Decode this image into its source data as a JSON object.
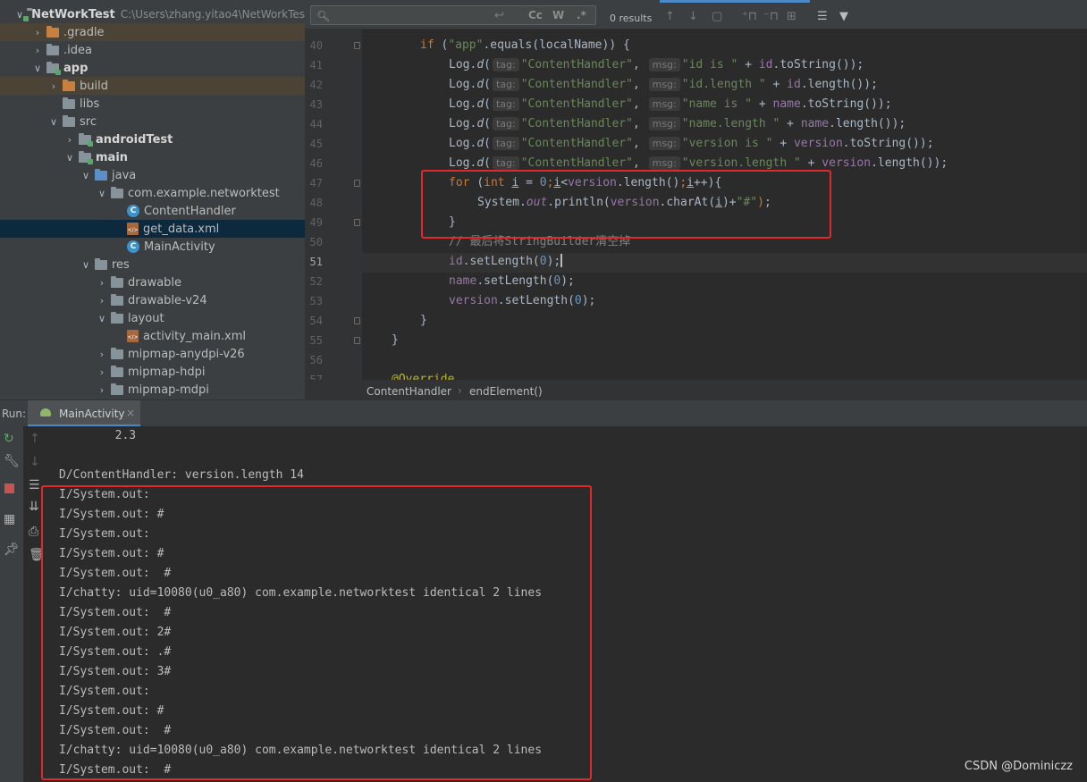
{
  "project_tree": {
    "items": [
      {
        "label": "NetWorkTest",
        "path": "C:\\Users\\zhang.yitao4\\NetWorkTes",
        "arrow": "v",
        "indent": 0,
        "icon": "folder-module",
        "bold": true
      },
      {
        "label": ".gradle",
        "arrow": ">",
        "indent": 1,
        "icon": "folder-orange",
        "highlight": true
      },
      {
        "label": ".idea",
        "arrow": ">",
        "indent": 1,
        "icon": "folder"
      },
      {
        "label": "app",
        "arrow": "v",
        "indent": 1,
        "icon": "folder-module",
        "bold": true
      },
      {
        "label": "build",
        "arrow": ">",
        "indent": 2,
        "icon": "folder-orange",
        "highlight": true
      },
      {
        "label": "libs",
        "arrow": "",
        "indent": 2,
        "icon": "folder"
      },
      {
        "label": "src",
        "arrow": "v",
        "indent": 2,
        "icon": "folder"
      },
      {
        "label": "androidTest",
        "arrow": ">",
        "indent": 3,
        "icon": "folder-module",
        "bold": true
      },
      {
        "label": "main",
        "arrow": "v",
        "indent": 3,
        "icon": "folder-module",
        "bold": true
      },
      {
        "label": "java",
        "arrow": "v",
        "indent": 4,
        "icon": "folder-blue"
      },
      {
        "label": "com.example.networktest",
        "arrow": "v",
        "indent": 5,
        "icon": "folder"
      },
      {
        "label": "ContentHandler",
        "arrow": "",
        "indent": 6,
        "icon": "class"
      },
      {
        "label": "get_data.xml",
        "arrow": "",
        "indent": 6,
        "icon": "xml",
        "selected": true
      },
      {
        "label": "MainActivity",
        "arrow": "",
        "indent": 6,
        "icon": "class"
      },
      {
        "label": "res",
        "arrow": "v",
        "indent": 4,
        "icon": "folder"
      },
      {
        "label": "drawable",
        "arrow": ">",
        "indent": 5,
        "icon": "folder"
      },
      {
        "label": "drawable-v24",
        "arrow": ">",
        "indent": 5,
        "icon": "folder"
      },
      {
        "label": "layout",
        "arrow": "v",
        "indent": 5,
        "icon": "folder"
      },
      {
        "label": "activity_main.xml",
        "arrow": "",
        "indent": 6,
        "icon": "xml"
      },
      {
        "label": "mipmap-anydpi-v26",
        "arrow": ">",
        "indent": 5,
        "icon": "folder"
      },
      {
        "label": "mipmap-hdpi",
        "arrow": ">",
        "indent": 5,
        "icon": "folder"
      },
      {
        "label": "mipmap-mdpi",
        "arrow": ">",
        "indent": 5,
        "icon": "folder"
      }
    ]
  },
  "search": {
    "match_case": "Cc",
    "words": "W",
    "regex": ".*",
    "results": "0 results"
  },
  "editor": {
    "current_line": "51",
    "lines": [
      {
        "n": "40",
        "parts": [
          [
            "kw",
            "if "
          ],
          [
            "",
            "("
          ],
          [
            "str",
            "\"app\""
          ],
          [
            "",
            ".equals(localName)) {"
          ]
        ],
        "indent": 8
      },
      {
        "n": "41",
        "parts": [
          [
            "",
            "Log."
          ],
          [
            "fni",
            "d"
          ],
          [
            "",
            "("
          ],
          [
            "hint",
            "tag:"
          ],
          [
            "str",
            "\"ContentHandler\""
          ],
          [
            "",
            ", "
          ],
          [
            "hint",
            "msg:"
          ],
          [
            "str",
            "\"id is \""
          ],
          [
            "",
            " + "
          ],
          [
            "fld",
            "id"
          ],
          [
            "",
            ".toString());"
          ]
        ],
        "indent": 12
      },
      {
        "n": "42",
        "parts": [
          [
            "",
            "Log."
          ],
          [
            "fni",
            "d"
          ],
          [
            "",
            "("
          ],
          [
            "hint",
            "tag:"
          ],
          [
            "str",
            "\"ContentHandler\""
          ],
          [
            "",
            ", "
          ],
          [
            "hint",
            "msg:"
          ],
          [
            "str",
            "\"id.length \""
          ],
          [
            "",
            " + "
          ],
          [
            "fld",
            "id"
          ],
          [
            "",
            ".length());"
          ]
        ],
        "indent": 12
      },
      {
        "n": "43",
        "parts": [
          [
            "",
            "Log."
          ],
          [
            "fni",
            "d"
          ],
          [
            "",
            "("
          ],
          [
            "hint",
            "tag:"
          ],
          [
            "str",
            "\"ContentHandler\""
          ],
          [
            "",
            ", "
          ],
          [
            "hint",
            "msg:"
          ],
          [
            "str",
            "\"name is \""
          ],
          [
            "",
            " + "
          ],
          [
            "fld",
            "name"
          ],
          [
            "",
            ".toString());"
          ]
        ],
        "indent": 12
      },
      {
        "n": "44",
        "parts": [
          [
            "",
            "Log."
          ],
          [
            "fni",
            "d"
          ],
          [
            "",
            "("
          ],
          [
            "hint",
            "tag:"
          ],
          [
            "str",
            "\"ContentHandler\""
          ],
          [
            "",
            ", "
          ],
          [
            "hint",
            "msg:"
          ],
          [
            "str",
            "\"name.length \""
          ],
          [
            "",
            " + "
          ],
          [
            "fld",
            "name"
          ],
          [
            "",
            ".length());"
          ]
        ],
        "indent": 12
      },
      {
        "n": "45",
        "parts": [
          [
            "",
            "Log."
          ],
          [
            "fni",
            "d"
          ],
          [
            "",
            "("
          ],
          [
            "hint",
            "tag:"
          ],
          [
            "str",
            "\"ContentHandler\""
          ],
          [
            "",
            ", "
          ],
          [
            "hint",
            "msg:"
          ],
          [
            "str",
            "\"version is \""
          ],
          [
            "",
            " + "
          ],
          [
            "fld",
            "version"
          ],
          [
            "",
            ".toString());"
          ]
        ],
        "indent": 12
      },
      {
        "n": "46",
        "parts": [
          [
            "",
            "Log."
          ],
          [
            "fni",
            "d"
          ],
          [
            "",
            "("
          ],
          [
            "hint",
            "tag:"
          ],
          [
            "str",
            "\"ContentHandler\""
          ],
          [
            "",
            ", "
          ],
          [
            "hint",
            "msg:"
          ],
          [
            "str",
            "\"version.length \""
          ],
          [
            "",
            " + "
          ],
          [
            "fld",
            "version"
          ],
          [
            "",
            ".length());"
          ]
        ],
        "indent": 12
      },
      {
        "n": "47",
        "parts": [
          [
            "kw",
            "for "
          ],
          [
            "",
            "("
          ],
          [
            "kw",
            "int "
          ],
          [
            "ul",
            "i"
          ],
          [
            "",
            " = "
          ],
          [
            "num",
            "0"
          ],
          [
            "kw",
            ";"
          ],
          [
            "ul",
            "i"
          ],
          [
            "",
            "<"
          ],
          [
            "fld",
            "version"
          ],
          [
            "",
            ".length()"
          ],
          [
            "kw",
            ";"
          ],
          [
            "ul",
            "i"
          ],
          [
            "",
            "++){"
          ]
        ],
        "indent": 12
      },
      {
        "n": "48",
        "parts": [
          [
            "",
            "System."
          ],
          [
            "fldi",
            "out"
          ],
          [
            "",
            ".println("
          ],
          [
            "fld",
            "version"
          ],
          [
            "",
            ".charAt("
          ],
          [
            "ul",
            "i"
          ],
          [
            "",
            ")+"
          ],
          [
            "str",
            "\"#\""
          ],
          [
            "kw",
            ")"
          ],
          [
            "",
            ";"
          ]
        ],
        "indent": 16
      },
      {
        "n": "49",
        "parts": [
          [
            "",
            "}"
          ]
        ],
        "indent": 12
      },
      {
        "n": "50",
        "parts": [
          [
            "cmt",
            "// 最后将StringBuilder清空掉"
          ]
        ],
        "indent": 12
      },
      {
        "n": "51",
        "parts": [
          [
            "fld",
            "id"
          ],
          [
            "",
            ".setLength("
          ],
          [
            "num",
            "0"
          ],
          [
            "",
            ");"
          ],
          [
            "caret",
            ""
          ]
        ],
        "indent": 12
      },
      {
        "n": "52",
        "parts": [
          [
            "fld",
            "name"
          ],
          [
            "",
            ".setLength("
          ],
          [
            "num",
            "0"
          ],
          [
            "",
            ");"
          ]
        ],
        "indent": 12
      },
      {
        "n": "53",
        "parts": [
          [
            "fld",
            "version"
          ],
          [
            "",
            ".setLength("
          ],
          [
            "num",
            "0"
          ],
          [
            "",
            ");"
          ]
        ],
        "indent": 12
      },
      {
        "n": "54",
        "parts": [
          [
            "",
            "}"
          ]
        ],
        "indent": 8
      },
      {
        "n": "55",
        "parts": [
          [
            "",
            "}"
          ]
        ],
        "indent": 4
      },
      {
        "n": "56",
        "parts": [],
        "indent": 0
      },
      {
        "n": "57",
        "parts": [
          [
            "ann",
            "@Override"
          ]
        ],
        "indent": 4
      }
    ]
  },
  "breadcrumb": {
    "class": "ContentHandler",
    "method": "endElement()"
  },
  "run": {
    "label": "Run:",
    "tab": "MainActivity"
  },
  "console": {
    "lines": [
      "        2.3",
      "",
      "D/ContentHandler: version.length 14",
      "I/System.out: ",
      "I/System.out: #",
      "I/System.out: ",
      "I/System.out: #",
      "I/System.out:  #",
      "I/chatty: uid=10080(u0_a80) com.example.networktest identical 2 lines",
      "I/System.out:  #",
      "I/System.out: 2#",
      "I/System.out: .#",
      "I/System.out: 3#",
      "I/System.out: ",
      "I/System.out: #",
      "I/System.out:  #",
      "I/chatty: uid=10080(u0_a80) com.example.networktest identical 2 lines",
      "I/System.out:  #"
    ]
  },
  "watermark": "CSDN @Dominiczz",
  "colors": {
    "accent": "#4a88c7",
    "highlight_box": "#e1292b"
  }
}
